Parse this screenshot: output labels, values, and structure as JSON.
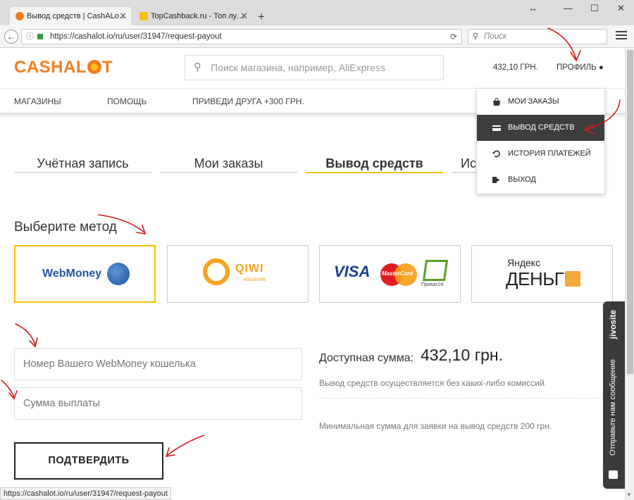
{
  "browser": {
    "tabs": [
      {
        "title": "Вывод средств | CashALo…",
        "active": true
      },
      {
        "title": "TopCashback.ru - Топ лу…",
        "active": false
      }
    ],
    "new_tab": "+",
    "window_controls": {
      "resize": "↔",
      "minimize": "—",
      "maximize": "☐",
      "close": "✕"
    },
    "url": "https://cashalot.io/ru/user/31947/request-payout",
    "search_placeholder": "Поиск"
  },
  "header": {
    "logo_left": "CASHAL",
    "logo_right": "T",
    "search_placeholder": "Поиск магазина, например, AliExpress",
    "balance": "432,10 ГРН.",
    "profile": "ПРОФИЛЬ"
  },
  "nav": {
    "items": [
      "МАГАЗИНЫ",
      "ПОМОЩЬ",
      "ПРИВЕДИ ДРУГА +300 ГРН."
    ]
  },
  "page_tabs": [
    {
      "label": "Учётная запись",
      "active": false
    },
    {
      "label": "Мои заказы",
      "active": false
    },
    {
      "label": "Вывод средств",
      "active": true
    },
    {
      "label": "Ис",
      "active": false
    }
  ],
  "profile_menu": {
    "items": [
      {
        "label": "МОИ ЗАКАЗЫ",
        "icon": "bag-icon",
        "active": false
      },
      {
        "label": "ВЫВОД СРЕДСТВ",
        "icon": "card-icon",
        "active": true
      },
      {
        "label": "ИСТОРИЯ ПЛАТЕЖЕЙ",
        "icon": "history-icon",
        "active": false
      },
      {
        "label": "ВЫХОД",
        "icon": "logout-icon",
        "active": false
      }
    ]
  },
  "method": {
    "title": "Выберите метод",
    "options": [
      {
        "name": "WebMoney",
        "selected": true
      },
      {
        "name": "QIWI",
        "sub": "кошелек",
        "selected": false
      },
      {
        "name": "VISA",
        "sub": "MasterCard",
        "extra": "Приват24",
        "selected": false
      },
      {
        "name": "Яндекс",
        "sub": "ДЕНЬГИ",
        "selected": false
      }
    ]
  },
  "form": {
    "wallet_placeholder": "Номер Вашего WebMoney кошелька",
    "amount_placeholder": "Сумма выплаты",
    "confirm": "ПОДТВЕРДИТЬ"
  },
  "available": {
    "label": "Доступная сумма:",
    "value": "432,10 грн.",
    "note_commission": "Вывод средств осуществляется без каких-либо комиссий.",
    "note_minimum": "Минимальная сумма для заявки на вывод средств 200 грн."
  },
  "chat": {
    "brand": "jivosite",
    "text": "Отправьте нам сообщение"
  },
  "status_url": "https://cashalot.io/ru/user/31947/request-payout",
  "colors": {
    "accent": "#f7c300",
    "brand_orange": "#f47c1e",
    "menu_active": "#3d3d3d"
  }
}
